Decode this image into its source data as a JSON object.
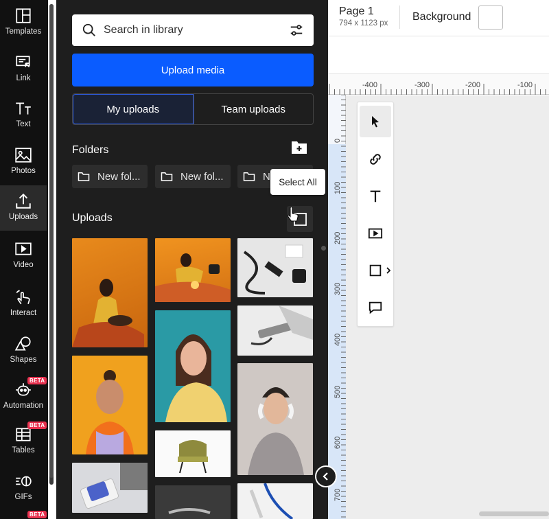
{
  "sidebar": {
    "items": [
      {
        "label": "Templates",
        "icon": "templates-icon"
      },
      {
        "label": "Link",
        "icon": "link-icon"
      },
      {
        "label": "Text",
        "icon": "text-icon"
      },
      {
        "label": "Photos",
        "icon": "photos-icon"
      },
      {
        "label": "Uploads",
        "icon": "uploads-icon",
        "active": true
      },
      {
        "label": "Video",
        "icon": "video-icon"
      },
      {
        "label": "Interact",
        "icon": "interact-icon"
      },
      {
        "label": "Shapes",
        "icon": "shapes-icon"
      },
      {
        "label": "Automation",
        "icon": "automation-icon",
        "badge": "BETA"
      },
      {
        "label": "Tables",
        "icon": "tables-icon",
        "badge": "BETA"
      },
      {
        "label": "GIFs",
        "icon": "gifs-icon"
      }
    ],
    "extra_badge": "BETA"
  },
  "panel": {
    "search_placeholder": "Search in library",
    "upload_label": "Upload media",
    "tabs": [
      {
        "label": "My uploads",
        "active": true
      },
      {
        "label": "Team uploads",
        "active": false
      }
    ],
    "folders_title": "Folders",
    "folders": [
      "New fol...",
      "New fol...",
      "N"
    ],
    "tooltip": "Select All",
    "uploads_title": "Uploads"
  },
  "editor": {
    "page_label": "Page 1",
    "page_size": "794 x 1123 px",
    "background_label": "Background",
    "hruler_ticks": [
      "-400",
      "-300",
      "-200",
      "-100"
    ],
    "vruler_ticks": [
      "0",
      "100",
      "200",
      "300",
      "400",
      "500",
      "600",
      "700"
    ]
  },
  "colors": {
    "accent": "#0a5cff",
    "panel_bg": "#1e1e1e",
    "rail_bg": "#111111",
    "beta": "#e8314f"
  }
}
